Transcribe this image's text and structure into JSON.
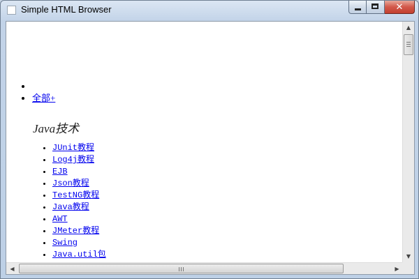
{
  "window": {
    "title": "Simple HTML Browser",
    "close_glyph": "✕"
  },
  "content": {
    "nav_items": [
      {
        "label": ""
      },
      {
        "label": "全部+"
      }
    ],
    "category_heading": "Java技术",
    "links": [
      "JUnit教程",
      "Log4j教程",
      "EJB",
      "Json教程",
      "TestNG教程",
      "Java教程",
      "AWT",
      "JMeter教程",
      "Swing",
      "Java.util包"
    ],
    "link_color": "#0000ee"
  },
  "scrollbars": {
    "up_arrow": "▲",
    "down_arrow": "▼",
    "left_arrow": "◀",
    "right_arrow": "▶"
  },
  "icons": [
    "app-icon",
    "minimize-icon",
    "maximize-icon",
    "close-icon",
    "grip-icon"
  ]
}
